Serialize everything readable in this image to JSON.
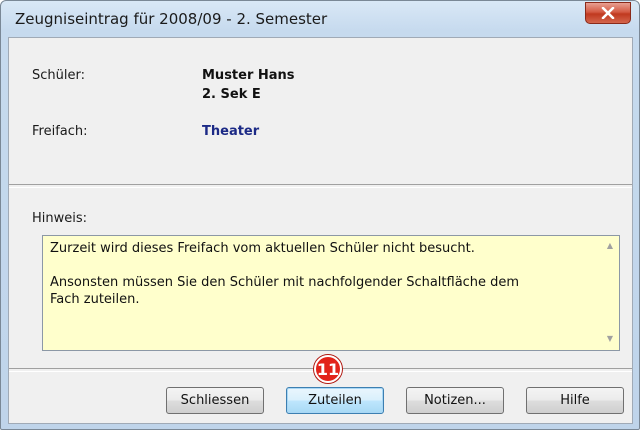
{
  "window": {
    "title": "Zeugniseintrag für 2008/09 - 2. Semester",
    "close_icon": "close-icon"
  },
  "info": {
    "student_label": "Schüler:",
    "student_name": "Muster Hans",
    "student_class": "2. Sek E",
    "subject_label": "Freifach:",
    "subject_value": "Theater"
  },
  "hint": {
    "label": "Hinweis:",
    "text": "Zurzeit wird dieses Freifach vom aktuellen Schüler nicht besucht.\n\nAnsonsten müssen Sie den Schüler mit nachfolgender Schaltfläche dem\nFach zuteilen."
  },
  "buttons": {
    "close": "Schliessen",
    "assign": "Zuteilen",
    "notes": "Notizen...",
    "help": "Hilfe"
  },
  "callout": {
    "number": "11"
  },
  "colors": {
    "subject_value": "#1c2a86",
    "note_background": "#ffffcc",
    "callout": "#e2231a",
    "close_button": "#c0391f"
  }
}
